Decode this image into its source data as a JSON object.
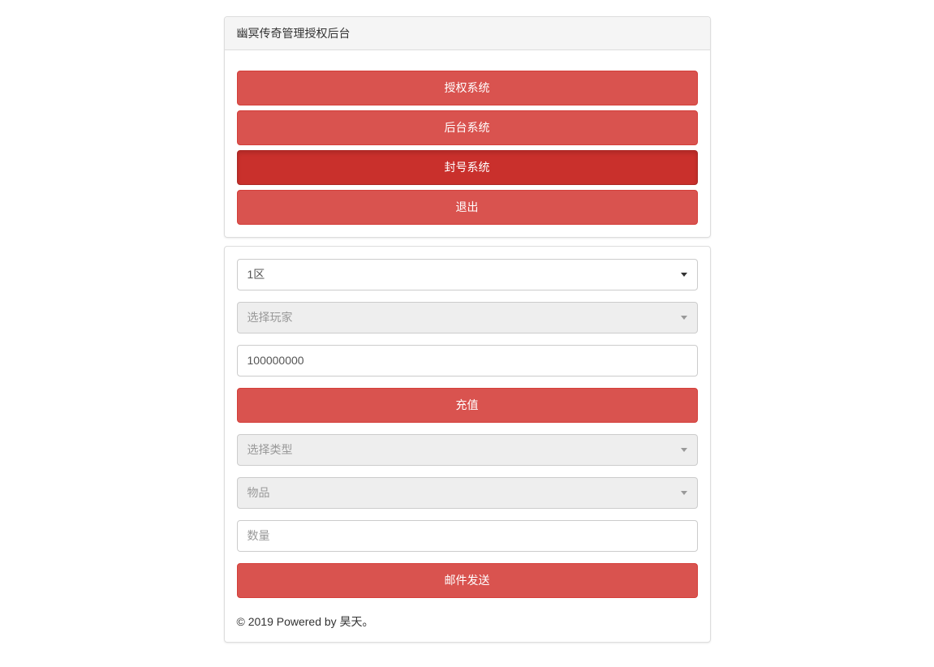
{
  "header": {
    "title": "幽冥传奇管理授权后台"
  },
  "nav": {
    "authorize": "授权系统",
    "backend": "后台系统",
    "ban": "封号系统",
    "exit": "退出"
  },
  "form": {
    "zone_selected": "1区",
    "player_placeholder": "选择玩家",
    "amount_value": "100000000",
    "recharge_label": "充值",
    "type_placeholder": "选择类型",
    "item_placeholder": "物品",
    "quantity_placeholder": "数量",
    "mail_send_label": "邮件发送"
  },
  "footer": {
    "text": "© 2019 Powered by 昊天。"
  }
}
